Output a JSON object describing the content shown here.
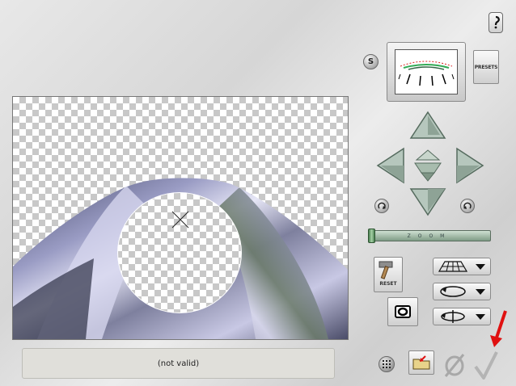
{
  "status": {
    "text": "(not valid)"
  },
  "buttons": {
    "s_label": "S",
    "presets_label": "PRESETS",
    "reset_label": "RESET",
    "zoom_label": "ZOOM"
  },
  "icons": {
    "help": "help-icon",
    "pan_up": "arrow-up-icon",
    "pan_down": "arrow-down-icon",
    "pan_left": "arrow-left-icon",
    "pan_right": "arrow-right-icon",
    "center": "center-pyramid-icon",
    "rotate_left": "rotate-left-icon",
    "rotate_right": "rotate-right-icon",
    "grid": "grid-icon",
    "folder": "folder-icon",
    "cancel": "cancel-icon",
    "ok": "checkmark-icon"
  },
  "colors": {
    "arrow": "#b6c7bd",
    "zoom": "#7f9c86",
    "red_pointer": "#e01010",
    "tube_dark": "#2d3146",
    "tube_light": "#dcdcf0"
  }
}
